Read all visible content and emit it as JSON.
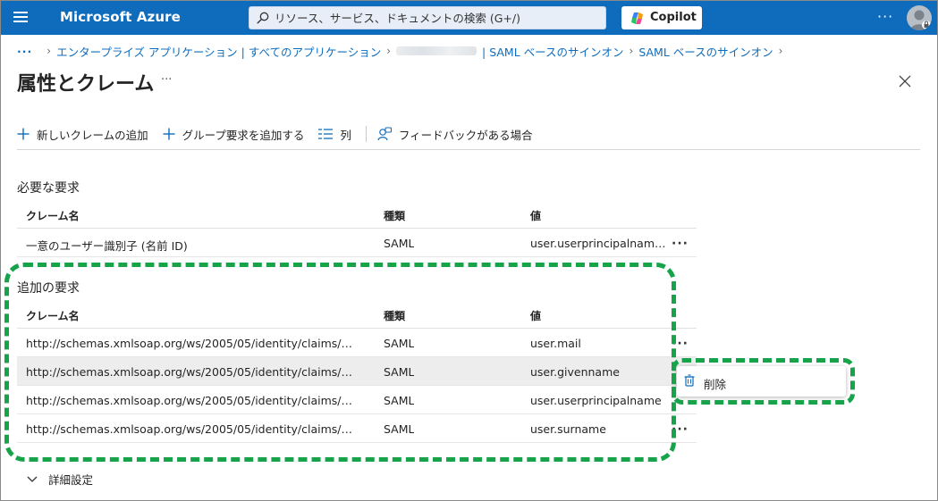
{
  "topbar": {
    "brand": "Microsoft Azure",
    "search_placeholder": "リソース、サービス、ドキュメントの検索 (G+/)",
    "copilot_label": "Copilot",
    "more_label": "···"
  },
  "breadcrumb": {
    "dots": "···",
    "items": [
      "エンタープライズ アプリケーション | すべてのアプリケーション",
      "| SAML ベースのサインオン",
      "SAML ベースのサインオン"
    ]
  },
  "page": {
    "title": "属性とクレーム",
    "more": "···"
  },
  "toolbar": {
    "add_claim": "新しいクレームの追加",
    "add_group": "グループ要求を追加する",
    "columns": "列",
    "feedback": "フィードバックがある場合"
  },
  "required": {
    "title": "必要な要求",
    "headers": [
      "クレーム名",
      "種類",
      "値"
    ],
    "rows": [
      {
        "name": "一意のユーザー識別子 (名前 ID)",
        "type": "SAML",
        "value": "user.userprincipalnam…"
      }
    ]
  },
  "additional": {
    "title": "追加の要求",
    "headers": [
      "クレーム名",
      "種類",
      "値"
    ],
    "rows": [
      {
        "name": "http://schemas.xmlsoap.org/ws/2005/05/identity/claims/…",
        "type": "SAML",
        "value": "user.mail"
      },
      {
        "name": "http://schemas.xmlsoap.org/ws/2005/05/identity/claims/…",
        "type": "SAML",
        "value": "user.givenname"
      },
      {
        "name": "http://schemas.xmlsoap.org/ws/2005/05/identity/claims/…",
        "type": "SAML",
        "value": "user.userprincipalname"
      },
      {
        "name": "http://schemas.xmlsoap.org/ws/2005/05/identity/claims/…",
        "type": "SAML",
        "value": "user.surname"
      }
    ]
  },
  "context_menu": {
    "delete_label": "削除"
  },
  "advanced": {
    "label": "詳細設定"
  },
  "colors": {
    "topbar": "#0f6cbd",
    "link": "#0f6cbd",
    "highlight": "#16a34a"
  }
}
